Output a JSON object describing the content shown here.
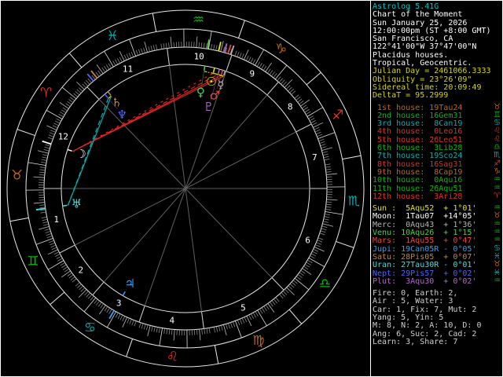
{
  "colors": {
    "bg": "#000000",
    "frame": "#ffffff",
    "ring": "#e8e8e8",
    "tick_minor": "#888888",
    "tick_mid": "#bbbbbb",
    "tick_major": "#dddddd",
    "cusp_line": "#606060",
    "house_divider": "#cccccc",
    "house_num": "#ffffff",
    "title": "#00c8c8",
    "info": "#ffffff",
    "astro": "#d6d600",
    "stats": "#d0d0d0",
    "fire": "#e03020",
    "earth": "#c06818",
    "air": "#00bb00",
    "water": "#00b0b0",
    "con": "#d6d600",
    "squ": "#dd2222",
    "sex": "#00b0b0"
  },
  "title_lines": [
    {
      "text": "Astrolog 5.41G",
      "color_key": "title"
    },
    {
      "text": "Chart of the Moment",
      "color_key": "info"
    },
    {
      "text": "Sun January 25, 2026",
      "color_key": "info"
    },
    {
      "text": "12:00:00pm (ST +8:00 GMT)",
      "color_key": "info"
    },
    {
      "text": "San Francisco, CA",
      "color_key": "info"
    },
    {
      "text": "122°41'00\"W 37°47'00\"N",
      "color_key": "info"
    },
    {
      "text": "Placidus houses.",
      "color_key": "info"
    },
    {
      "text": "Tropical, Geocentric.",
      "color_key": "info"
    },
    {
      "text": "Julian Day = 2461066.3333",
      "color_key": "astro"
    },
    {
      "text": "Obliquity = 23°26'09\"",
      "color_key": "astro"
    },
    {
      "text": "Sidereal time: 20:09:49",
      "color_key": "astro"
    },
    {
      "text": "DeltaT = 95.2999",
      "color_key": "astro"
    }
  ],
  "houses": [
    {
      "text": " 1st house: 19Tau24",
      "lon": 49.4,
      "sign": "Taurus",
      "glyph": "♉",
      "element": "earth"
    },
    {
      "text": " 2nd house: 16Gem31",
      "lon": 76.517,
      "sign": "Gemini",
      "glyph": "♊",
      "element": "air"
    },
    {
      "text": " 3rd house:  8Can19",
      "lon": 98.317,
      "sign": "Cancer",
      "glyph": "♋",
      "element": "water"
    },
    {
      "text": " 4th house:  0Leo16",
      "lon": 120.267,
      "sign": "Leo",
      "glyph": "♌",
      "element": "fire"
    },
    {
      "text": " 5th house: 26Leo51",
      "lon": 146.85,
      "sign": "Leo",
      "glyph": "♌",
      "element": "fire"
    },
    {
      "text": " 6th house:  3Lib28",
      "lon": 183.467,
      "sign": "Libra",
      "glyph": "♎",
      "element": "air"
    },
    {
      "text": " 7th house: 19Sco24",
      "lon": 229.4,
      "sign": "Scorpio",
      "glyph": "♏",
      "element": "water"
    },
    {
      "text": " 8th house: 16Sag31",
      "lon": 256.517,
      "sign": "Sagittarius",
      "glyph": "♐",
      "element": "fire"
    },
    {
      "text": " 9th house:  8Cap19",
      "lon": 278.317,
      "sign": "Capricorn",
      "glyph": "♑",
      "element": "earth"
    },
    {
      "text": "10th house:  0Aqu16",
      "lon": 300.267,
      "sign": "Aquarius",
      "glyph": "♒",
      "element": "air"
    },
    {
      "text": "11th house: 26Aqu51",
      "lon": 326.85,
      "sign": "Aquarius",
      "glyph": "♒",
      "element": "air"
    },
    {
      "text": "12th house:  3Ari28",
      "lon": 3.467,
      "sign": "Aries",
      "glyph": "♈",
      "element": "fire"
    }
  ],
  "planets": [
    {
      "name": "Sun",
      "text": "Sun :  5Aqu52  + 1°01'",
      "lon": 305.867,
      "glyph": "☉",
      "sign_glyph": "♒",
      "element": "air",
      "color": "#e6e600",
      "retrograde": false
    },
    {
      "name": "Moon",
      "text": "Moon:  1Tau07  +14°05'",
      "lon": 31.117,
      "glyph": "☽",
      "sign_glyph": "♉",
      "element": "earth",
      "color": "#ffffff",
      "retrograde": false
    },
    {
      "name": "Merc",
      "text": "Merc:  0Aqu43  + 1°36'",
      "lon": 300.717,
      "glyph": "☿",
      "sign_glyph": "♒",
      "element": "air",
      "color": "#b4b4b4",
      "retrograde": false
    },
    {
      "name": "Venu",
      "text": "Venu: 10Aqu26  + 1°15'",
      "lon": 310.433,
      "glyph": "♀",
      "sign_glyph": "♒",
      "element": "air",
      "color": "#55cc55",
      "retrograde": false
    },
    {
      "name": "Mars",
      "text": "Mars:  1Aqu55  + 0°47'",
      "lon": 301.917,
      "glyph": "♂",
      "sign_glyph": "♒",
      "element": "air",
      "color": "#ee4444",
      "retrograde": false
    },
    {
      "name": "Jupi",
      "text": "Jupi: 19Can05R - 0°05'",
      "lon": 109.083,
      "glyph": "♃",
      "sign_glyph": "♋",
      "element": "water",
      "color": "#30a0ff",
      "retrograde": true
    },
    {
      "name": "Satu",
      "text": "Satu: 28Pis05  + 0°07'",
      "lon": 358.083,
      "glyph": "♄",
      "sign_glyph": "♓",
      "element": "water",
      "color": "#c08840",
      "retrograde": false
    },
    {
      "name": "Uran",
      "text": "Uran: 27Tau30R - 0°01'",
      "lon": 57.5,
      "glyph": "♅",
      "sign_glyph": "♉",
      "element": "earth",
      "color": "#40e0e0",
      "retrograde": true
    },
    {
      "name": "Nept",
      "text": "Nept: 29Pis57  + 0°02'",
      "lon": 359.95,
      "glyph": "♆",
      "sign_glyph": "♓",
      "element": "water",
      "color": "#5060ff",
      "retrograde": false
    },
    {
      "name": "Plut",
      "text": "Plut:  3Aqu30  + 0°02'",
      "lon": 303.5,
      "glyph": "♇",
      "sign_glyph": "♒",
      "element": "air",
      "color": "#b06cc8",
      "retrograde": false
    }
  ],
  "stats": [
    "Fire: 0, Earth: 2,",
    "Air : 5, Water: 3",
    "Car: 1, Fix: 7, Mut: 2",
    "Yang: 5, Yin: 5",
    "M: 8, N: 2, A: 10, D: 0",
    "Ang: 6, Suc: 2, Cad: 2",
    "Learn: 3, Share: 7"
  ],
  "signs": [
    {
      "name": "Aries",
      "glyph": "♈",
      "element": "fire"
    },
    {
      "name": "Taurus",
      "glyph": "♉",
      "element": "earth"
    },
    {
      "name": "Gemini",
      "glyph": "♊",
      "element": "air"
    },
    {
      "name": "Cancer",
      "glyph": "♋",
      "element": "water"
    },
    {
      "name": "Leo",
      "glyph": "♌",
      "element": "fire"
    },
    {
      "name": "Virgo",
      "glyph": "♍",
      "element": "earth"
    },
    {
      "name": "Libra",
      "glyph": "♎",
      "element": "air"
    },
    {
      "name": "Scorpio",
      "glyph": "♏",
      "element": "water"
    },
    {
      "name": "Sagittarius",
      "glyph": "♐",
      "element": "fire"
    },
    {
      "name": "Capricorn",
      "glyph": "♑",
      "element": "earth"
    },
    {
      "name": "Aquarius",
      "glyph": "♒",
      "element": "air"
    },
    {
      "name": "Pisces",
      "glyph": "♓",
      "element": "water"
    }
  ],
  "wheel": {
    "ascendant_lon": 49.4,
    "house_numbers": [
      "1",
      "2",
      "3",
      "4",
      "5",
      "6",
      "7",
      "8",
      "9",
      "10",
      "11",
      "12"
    ]
  },
  "aspects": [
    {
      "p1": "Moon",
      "p2": "Merc",
      "type": "squ",
      "style": "solid"
    },
    {
      "p1": "Moon",
      "p2": "Mars",
      "type": "squ",
      "style": "solid"
    },
    {
      "p1": "Moon",
      "p2": "Plut",
      "type": "squ",
      "style": "dashed"
    },
    {
      "p1": "Moon",
      "p2": "Sun",
      "type": "squ",
      "style": "wide"
    },
    {
      "p1": "Sun",
      "p2": "Merc",
      "type": "con",
      "style": "wide"
    },
    {
      "p1": "Sun",
      "p2": "Mars",
      "type": "con",
      "style": "dashed"
    },
    {
      "p1": "Sun",
      "p2": "Plut",
      "type": "con",
      "style": "dashed"
    },
    {
      "p1": "Sun",
      "p2": "Venu",
      "type": "con",
      "style": "wide"
    },
    {
      "p1": "Merc",
      "p2": "Mars",
      "type": "con",
      "style": "solid"
    },
    {
      "p1": "Merc",
      "p2": "Plut",
      "type": "con",
      "style": "dashed"
    },
    {
      "p1": "Mars",
      "p2": "Plut",
      "type": "con",
      "style": "dashed"
    },
    {
      "p1": "Venu",
      "p2": "Plut",
      "type": "con",
      "style": "dotted"
    },
    {
      "p1": "Satu",
      "p2": "Nept",
      "type": "con",
      "style": "dashed"
    },
    {
      "p1": "Satu",
      "p2": "Uran",
      "type": "sex",
      "style": "solid"
    },
    {
      "p1": "Nept",
      "p2": "Uran",
      "type": "sex",
      "style": "dashed"
    }
  ]
}
